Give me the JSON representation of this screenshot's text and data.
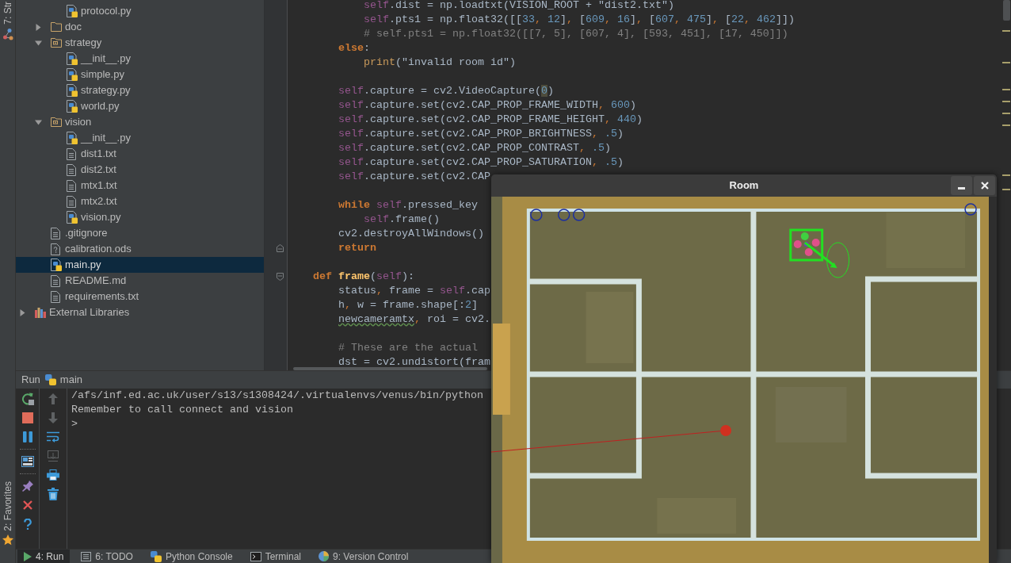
{
  "left_stripe": {
    "top_tab": "7: Str",
    "bottom_tab": "2: Favorites"
  },
  "project_tree": [
    {
      "children": [
        {
          "children": [
            {
              "name": "protocol.py",
              "kind": "python",
              "selected": false
            }
          ]
        },
        {
          "name": "doc",
          "kind": "folder",
          "expanded": false,
          "selected": false
        },
        {
          "name": "strategy",
          "kind": "package",
          "expanded": true,
          "selected": false,
          "children": [
            {
              "name": "__init__.py",
              "kind": "python",
              "selected": false
            },
            {
              "name": "simple.py",
              "kind": "python",
              "selected": false
            },
            {
              "name": "strategy.py",
              "kind": "python",
              "selected": false
            },
            {
              "name": "world.py",
              "kind": "python",
              "selected": false
            }
          ]
        },
        {
          "name": "vision",
          "kind": "package",
          "expanded": true,
          "selected": false,
          "children": [
            {
              "name": "__init__.py",
              "kind": "python",
              "selected": false
            },
            {
              "name": "dist1.txt",
              "kind": "text",
              "selected": false
            },
            {
              "name": "dist2.txt",
              "kind": "text",
              "selected": false
            },
            {
              "name": "mtx1.txt",
              "kind": "text",
              "selected": false
            },
            {
              "name": "mtx2.txt",
              "kind": "text",
              "selected": false
            },
            {
              "name": "vision.py",
              "kind": "python",
              "selected": false
            }
          ]
        },
        {
          "name": ".gitignore",
          "kind": "text",
          "selected": false
        },
        {
          "name": "calibration.ods",
          "kind": "unknown",
          "selected": false
        },
        {
          "name": "main.py",
          "kind": "python",
          "selected": true
        },
        {
          "name": "README.md",
          "kind": "text",
          "selected": false
        },
        {
          "name": "requirements.txt",
          "kind": "text",
          "selected": false
        }
      ]
    },
    {
      "name": "External Libraries",
      "kind": "library",
      "expanded": false,
      "selected": false
    }
  ],
  "editor": {
    "lines": [
      {
        "kind": "code",
        "tokens": [
          {
            "kind": "self",
            "text": "            self"
          },
          {
            "kind": "plain",
            "text": ".dist = np.loadtxt(VISION_ROOT + \"dist2.txt\")"
          }
        ]
      },
      {
        "kind": "code",
        "tokens": [
          {
            "kind": "self",
            "text": "            self"
          },
          {
            "kind": "plain",
            "text": ".pts1 = np.float32([["
          },
          {
            "kind": "number",
            "text": "33"
          },
          {
            "kind": "comma",
            "text": ", "
          },
          {
            "kind": "number",
            "text": "12"
          },
          {
            "kind": "plain",
            "text": "]"
          },
          {
            "kind": "comma",
            "text": ", "
          },
          {
            "kind": "plain",
            "text": "["
          },
          {
            "kind": "number",
            "text": "609"
          },
          {
            "kind": "comma",
            "text": ", "
          },
          {
            "kind": "number",
            "text": "16"
          },
          {
            "kind": "plain",
            "text": "]"
          },
          {
            "kind": "comma",
            "text": ", "
          },
          {
            "kind": "plain",
            "text": "["
          },
          {
            "kind": "number",
            "text": "607"
          },
          {
            "kind": "comma",
            "text": ", "
          },
          {
            "kind": "number",
            "text": "475"
          },
          {
            "kind": "plain",
            "text": "]"
          },
          {
            "kind": "comma",
            "text": ", "
          },
          {
            "kind": "plain",
            "text": "["
          },
          {
            "kind": "number",
            "text": "22"
          },
          {
            "kind": "comma",
            "text": ", "
          },
          {
            "kind": "number",
            "text": "462"
          },
          {
            "kind": "plain",
            "text": "]])"
          }
        ]
      },
      {
        "kind": "code",
        "tokens": [
          {
            "kind": "comment",
            "text": "            # self.pts1 = np.float32([[7, 5], [607, 4], [593, 451], [17, 450]])"
          }
        ]
      },
      {
        "kind": "code",
        "tokens": [
          {
            "kind": "keyword",
            "text": "        else"
          },
          {
            "kind": "plain",
            "text": ":"
          }
        ]
      },
      {
        "kind": "code",
        "tokens": [
          {
            "kind": "builtin",
            "text": "            print"
          },
          {
            "kind": "plain",
            "text": "(\"invalid room id\")"
          }
        ]
      },
      {
        "kind": "blank"
      },
      {
        "kind": "code",
        "tokens": [
          {
            "kind": "self",
            "text": "        self"
          },
          {
            "kind": "plain",
            "text": ".capture = cv2.VideoCapture("
          },
          {
            "kind": "highlight",
            "text": "0"
          },
          {
            "kind": "plain",
            "text": ")"
          }
        ]
      },
      {
        "kind": "code",
        "tokens": [
          {
            "kind": "self",
            "text": "        self"
          },
          {
            "kind": "plain",
            "text": ".capture.set(cv2.CAP_PROP_FRAME_WIDTH"
          },
          {
            "kind": "comma",
            "text": ", "
          },
          {
            "kind": "number",
            "text": "600"
          },
          {
            "kind": "plain",
            "text": ")"
          }
        ]
      },
      {
        "kind": "code",
        "tokens": [
          {
            "kind": "self",
            "text": "        self"
          },
          {
            "kind": "plain",
            "text": ".capture.set(cv2.CAP_PROP_FRAME_HEIGHT"
          },
          {
            "kind": "comma",
            "text": ", "
          },
          {
            "kind": "number",
            "text": "440"
          },
          {
            "kind": "plain",
            "text": ")"
          }
        ]
      },
      {
        "kind": "code",
        "tokens": [
          {
            "kind": "self",
            "text": "        self"
          },
          {
            "kind": "plain",
            "text": ".capture.set(cv2.CAP_PROP_BRIGHTNESS"
          },
          {
            "kind": "comma",
            "text": ", "
          },
          {
            "kind": "number",
            "text": ".5"
          },
          {
            "kind": "plain",
            "text": ")"
          }
        ]
      },
      {
        "kind": "code",
        "tokens": [
          {
            "kind": "self",
            "text": "        self"
          },
          {
            "kind": "plain",
            "text": ".capture.set(cv2.CAP_PROP_CONTRAST"
          },
          {
            "kind": "comma",
            "text": ", "
          },
          {
            "kind": "number",
            "text": ".5"
          },
          {
            "kind": "plain",
            "text": ")"
          }
        ]
      },
      {
        "kind": "code",
        "tokens": [
          {
            "kind": "self",
            "text": "        self"
          },
          {
            "kind": "plain",
            "text": ".capture.set(cv2.CAP_PROP_SATURATION"
          },
          {
            "kind": "comma",
            "text": ", "
          },
          {
            "kind": "number",
            "text": ".5"
          },
          {
            "kind": "plain",
            "text": ")"
          }
        ]
      },
      {
        "kind": "code",
        "tokens": [
          {
            "kind": "self",
            "text": "        self"
          },
          {
            "kind": "plain",
            "text": ".capture.set(cv2.CAP"
          }
        ]
      },
      {
        "kind": "blank"
      },
      {
        "kind": "code",
        "tokens": [
          {
            "kind": "keyword",
            "text": "        while "
          },
          {
            "kind": "self",
            "text": "self"
          },
          {
            "kind": "plain",
            "text": ".pressed_key"
          }
        ]
      },
      {
        "kind": "code",
        "tokens": [
          {
            "kind": "self",
            "text": "            self"
          },
          {
            "kind": "plain",
            "text": ".frame()"
          }
        ]
      },
      {
        "kind": "code",
        "tokens": [
          {
            "kind": "plain",
            "text": "        cv2.destroyAllWindows()"
          }
        ]
      },
      {
        "kind": "code",
        "fold_marker": {
          "kind": "end",
          "expanded": true
        },
        "tokens": [
          {
            "kind": "keyword",
            "text": "        return"
          }
        ]
      },
      {
        "kind": "blank"
      },
      {
        "kind": "code",
        "fold_marker": {
          "kind": "start",
          "expanded": true
        },
        "tokens": [
          {
            "kind": "keyword",
            "text": "    def "
          },
          {
            "kind": "func",
            "text": "frame"
          },
          {
            "kind": "plain",
            "text": "("
          },
          {
            "kind": "self",
            "text": "self"
          },
          {
            "kind": "plain",
            "text": "):"
          }
        ]
      },
      {
        "kind": "code",
        "tokens": [
          {
            "kind": "plain",
            "text": "        status"
          },
          {
            "kind": "comma",
            "text": ", "
          },
          {
            "kind": "plain",
            "text": "frame = "
          },
          {
            "kind": "self",
            "text": "self"
          },
          {
            "kind": "plain",
            "text": ".cap"
          }
        ]
      },
      {
        "kind": "code",
        "tokens": [
          {
            "kind": "plain",
            "text": "        h"
          },
          {
            "kind": "comma",
            "text": ", "
          },
          {
            "kind": "plain",
            "text": "w = frame.shape[:"
          },
          {
            "kind": "number",
            "text": "2"
          },
          {
            "kind": "plain",
            "text": "]"
          }
        ]
      },
      {
        "kind": "code",
        "tokens": [
          {
            "kind": "typo",
            "text": "        newcameramtx"
          },
          {
            "kind": "comma",
            "text": ", "
          },
          {
            "kind": "plain",
            "text": "roi = cv2."
          }
        ]
      },
      {
        "kind": "blank"
      },
      {
        "kind": "code",
        "tokens": [
          {
            "kind": "comment",
            "text": "        # These are the actual"
          }
        ]
      },
      {
        "kind": "code",
        "tokens": [
          {
            "kind": "plain",
            "text": "        dst = cv2.undistort(fram"
          }
        ]
      }
    ]
  },
  "run_panel": {
    "title": "Run",
    "configuration": "main",
    "toolbar": {
      "column_1": [
        {
          "buttons": [
            {
              "kind": "rerun",
              "disabled": false
            },
            {
              "kind": "stop",
              "disabled": false
            },
            {
              "kind": "pause",
              "disabled": false
            }
          ]
        },
        {
          "buttons": [
            {
              "kind": "layout",
              "disabled": false
            }
          ]
        },
        {
          "buttons": [
            {
              "kind": "pin",
              "disabled": false
            },
            {
              "kind": "close",
              "disabled": false
            },
            {
              "kind": "help",
              "disabled": false
            }
          ]
        }
      ],
      "column_2": [
        {
          "buttons": [
            {
              "kind": "up",
              "disabled": true
            },
            {
              "kind": "down",
              "disabled": true
            },
            {
              "kind": "wrap",
              "disabled": false
            },
            {
              "kind": "scroll_end",
              "disabled": true
            },
            {
              "kind": "print",
              "disabled": false
            },
            {
              "kind": "trash",
              "disabled": false
            }
          ]
        }
      ]
    },
    "output": [
      "/afs/inf.ed.ac.uk/user/s13/s1308424/.virtualenvs/venus/bin/python",
      "Remember to call connect and vision"
    ],
    "prompt": ">"
  },
  "bottom_tabs": [
    {
      "label": "4: Run",
      "kind": "run",
      "selected": true
    },
    {
      "label": "6: TODO",
      "kind": "todo",
      "selected": false
    },
    {
      "label": "Python Console",
      "kind": "python_console",
      "selected": false
    },
    {
      "label": "Terminal",
      "kind": "terminal",
      "selected": false
    },
    {
      "label": "9: Version Control",
      "kind": "vcs",
      "selected": false
    }
  ],
  "room_window": {
    "title": "Room"
  }
}
